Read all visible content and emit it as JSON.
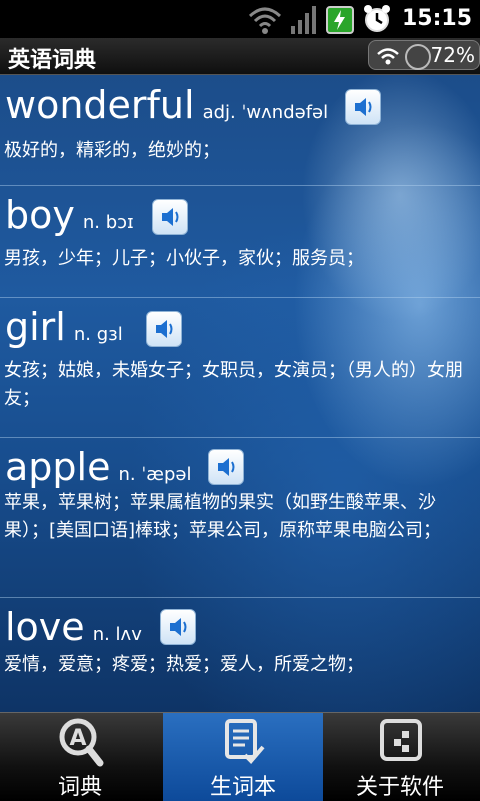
{
  "status_bar": {
    "time": "15:15"
  },
  "app": {
    "title": "英语词典",
    "battery_level": "72%"
  },
  "entries": [
    {
      "word": "wonderful",
      "pos_pron": "adj. ˈwʌndəfəl",
      "definition": "极好的，精彩的，绝妙的；"
    },
    {
      "word": "boy",
      "pos_pron": "n. bɔɪ",
      "definition": "男孩，少年；儿子；小伙子，家伙；服务员；"
    },
    {
      "word": "girl",
      "pos_pron": "n. gɜl",
      "definition": "女孩；姑娘，未婚女子；女职员，女演员；（男人的）女朋友；"
    },
    {
      "word": "apple",
      "pos_pron": "n. ˈæpəl",
      "definition": "苹果，苹果树；苹果属植物的果实（如野生酸苹果、沙果）；[美国口语]棒球；苹果公司，原称苹果电脑公司；"
    },
    {
      "word": "love",
      "pos_pron": "n. lʌv",
      "definition": "爱情，爱意；疼爱；热爱；爱人，所爱之物；"
    }
  ],
  "bottom_nav": {
    "tabs": [
      {
        "label": "词典",
        "icon": "dictionary-search-icon"
      },
      {
        "label": "生词本",
        "icon": "notebook-check-icon",
        "active": true
      },
      {
        "label": "关于软件",
        "icon": "about-icon"
      }
    ]
  }
}
